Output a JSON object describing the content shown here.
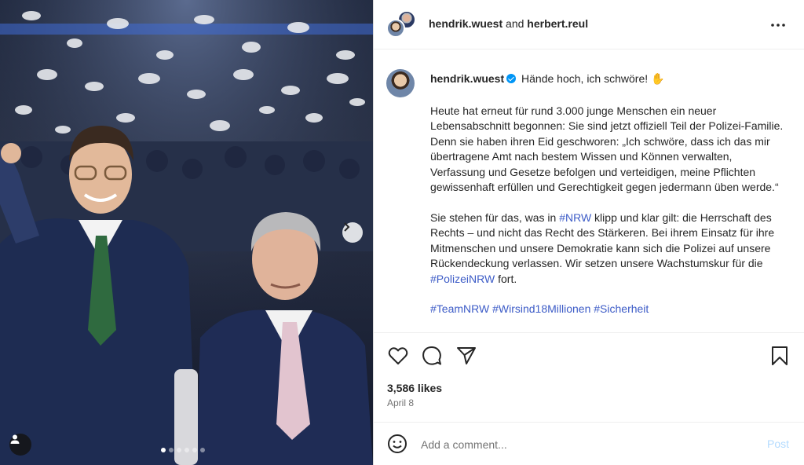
{
  "header": {
    "user1": "hendrik.wuest",
    "and": "and",
    "user2": "herbert.reul",
    "more_icon": "more-horizontal-icon"
  },
  "caption": {
    "username": "hendrik.wuest",
    "headline": "Hände hoch, ich schwöre! ✋",
    "paragraph1": "Heute hat erneut für rund 3.000 junge Menschen ein neuer Lebensabschnitt begonnen: Sie sind jetzt offiziell Teil der Polizei-Familie. Denn sie haben ihren Eid geschworen: „Ich schwöre, dass ich das mir übertragene Amt nach bestem Wissen und Können verwalten, Verfassung und Gesetze befolgen und verteidigen, meine Pflichten gewissenhaft erfüllen und Gerechtigkeit gegen jedermann üben werde.“",
    "p2_a": "Sie stehen für das, was in ",
    "p2_tag1": "#NRW",
    "p2_b": " klipp und klar gilt: die Herrschaft des Rechts – und nicht das Recht des Stärkeren. Bei ihrem Einsatz für ihre Mitmenschen und unsere Demokratie kann sich die Polizei auf unsere Rückendeckung verlassen. Wir setzen unsere Wachstumskur für die ",
    "p2_tag2": "#PolizeiNRW",
    "p2_c": " fort.",
    "hashtags": [
      "#TeamNRW",
      "#Wirsind18Millionen",
      "#Sicherheit"
    ]
  },
  "actions": {
    "like_icon": "heart-icon",
    "comment_icon": "comment-bubble-icon",
    "share_icon": "send-icon",
    "save_icon": "bookmark-icon",
    "likes": "3,586 likes",
    "date": "April 8"
  },
  "comment": {
    "placeholder": "Add a comment...",
    "post_label": "Post",
    "emoji_icon": "emoji-smile-icon"
  },
  "carousel": {
    "total": 6,
    "active_index": 0
  },
  "colors": {
    "hashtag": "#3d5cc7",
    "verified": "#0095f6",
    "post_disabled": "#b3dbff"
  }
}
